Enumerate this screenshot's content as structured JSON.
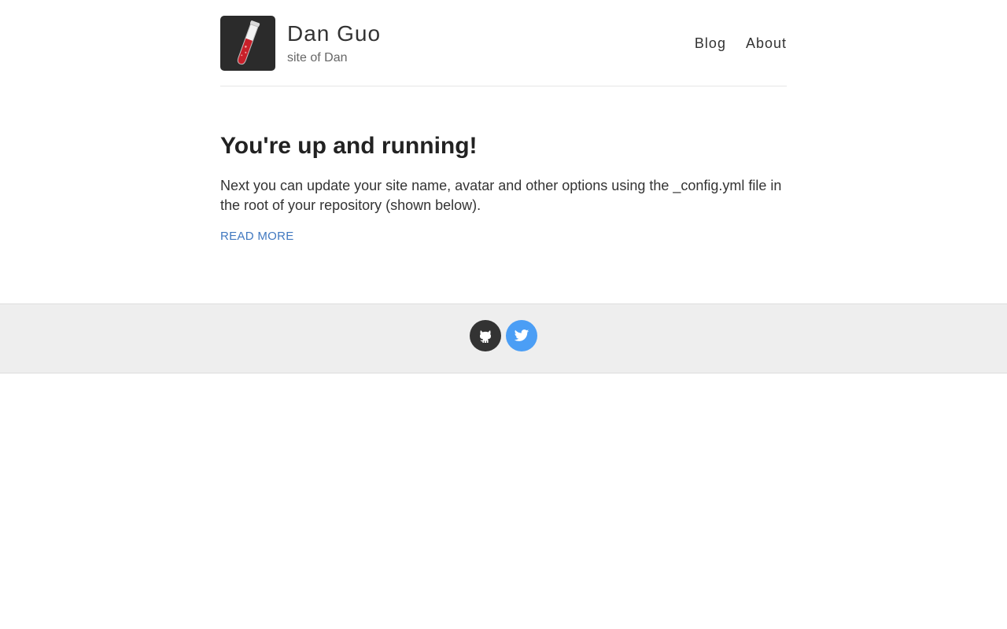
{
  "header": {
    "site_name": "Dan Guo",
    "site_description": "site of Dan",
    "avatar_icon": "test-tube-icon",
    "nav": [
      {
        "label": "Blog"
      },
      {
        "label": "About"
      }
    ]
  },
  "post": {
    "title": "You're up and running!",
    "excerpt": "Next you can update your site name, avatar and other options using the _config.yml file in the root of your repository (shown below).",
    "read_more": "READ MORE"
  },
  "footer": {
    "social": [
      {
        "icon": "github-icon",
        "color": "#333333"
      },
      {
        "icon": "twitter-icon",
        "color": "#4b9ef5"
      }
    ]
  },
  "colors": {
    "link": "#4078c0",
    "footer_bg": "#eeeeee",
    "avatar_bg": "#2b2b2b"
  }
}
